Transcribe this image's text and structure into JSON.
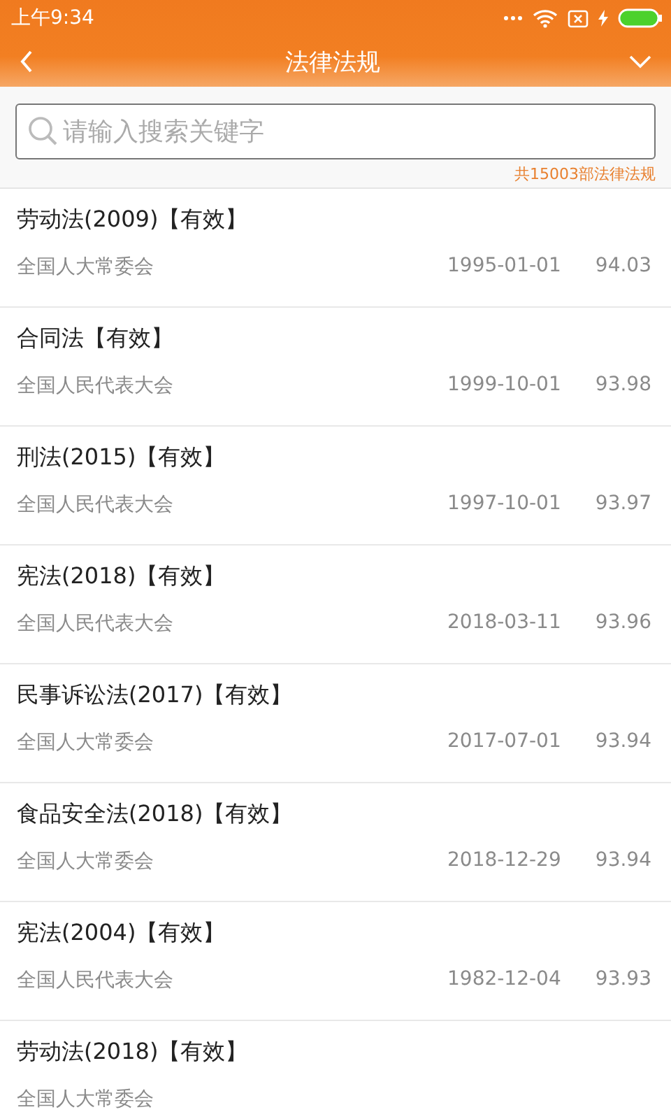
{
  "status_bar": {
    "time": "上午9:34"
  },
  "header": {
    "title": "法律法规"
  },
  "search": {
    "placeholder": "请输入搜索关键字"
  },
  "total": "共15003部法律法规",
  "laws": [
    {
      "title": "劳动法(2009)【有效】",
      "issuer": "全国人大常委会",
      "date": "1995-01-01",
      "score": "94.03"
    },
    {
      "title": "合同法【有效】",
      "issuer": "全国人民代表大会",
      "date": "1999-10-01",
      "score": "93.98"
    },
    {
      "title": "刑法(2015)【有效】",
      "issuer": "全国人民代表大会",
      "date": "1997-10-01",
      "score": "93.97"
    },
    {
      "title": "宪法(2018)【有效】",
      "issuer": "全国人民代表大会",
      "date": "2018-03-11",
      "score": "93.96"
    },
    {
      "title": "民事诉讼法(2017)【有效】",
      "issuer": "全国人大常委会",
      "date": "2017-07-01",
      "score": "93.94"
    },
    {
      "title": "食品安全法(2018)【有效】",
      "issuer": "全国人大常委会",
      "date": "2018-12-29",
      "score": "93.94"
    },
    {
      "title": "宪法(2004)【有效】",
      "issuer": "全国人民代表大会",
      "date": "1982-12-04",
      "score": "93.93"
    },
    {
      "title": "劳动法(2018)【有效】",
      "issuer": "全国人大常委会"
    }
  ]
}
